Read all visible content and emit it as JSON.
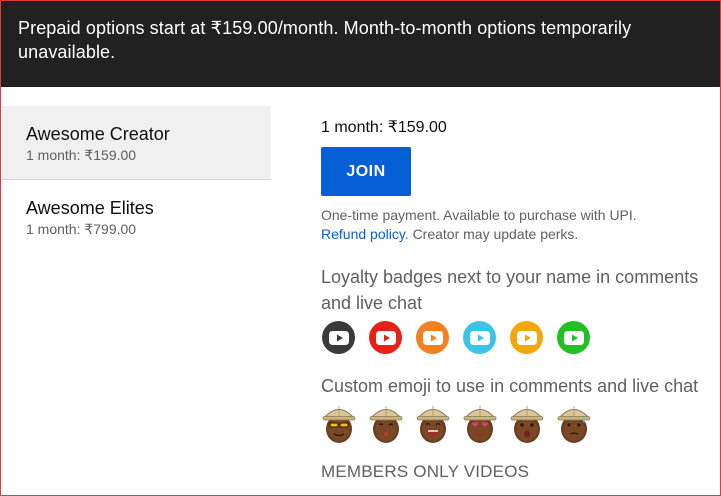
{
  "banner": {
    "text": "Prepaid options start at ₹159.00/month. Month-to-month options temporarily unavailable."
  },
  "tiers": [
    {
      "name": "Awesome Creator",
      "price": "1 month: ₹159.00",
      "selected": true
    },
    {
      "name": "Awesome Elites",
      "price": "1 month: ₹799.00",
      "selected": false
    }
  ],
  "main": {
    "price_line": "1 month: ₹159.00",
    "join_label": "JOIN",
    "payment_text": "One-time payment. Available to purchase with UPI.",
    "refund_link": "Refund policy",
    "payment_suffix": ". Creator may update perks."
  },
  "perks": {
    "badges_title": "Loyalty badges next to your name in comments and live chat",
    "badge_colors": [
      "#3a3a3a",
      "#e62117",
      "#f4801f",
      "#3ec3e8",
      "#f4a70d",
      "#22c022"
    ],
    "emoji_title": "Custom emoji to use in comments and live chat",
    "emoji_icons": [
      "emoji-sunglasses-icon",
      "emoji-kiss-icon",
      "emoji-laugh-icon",
      "emoji-heart-eyes-icon",
      "emoji-shocked-icon",
      "emoji-sweat-icon"
    ],
    "videos_title": "MEMBERS ONLY VIDEOS"
  }
}
